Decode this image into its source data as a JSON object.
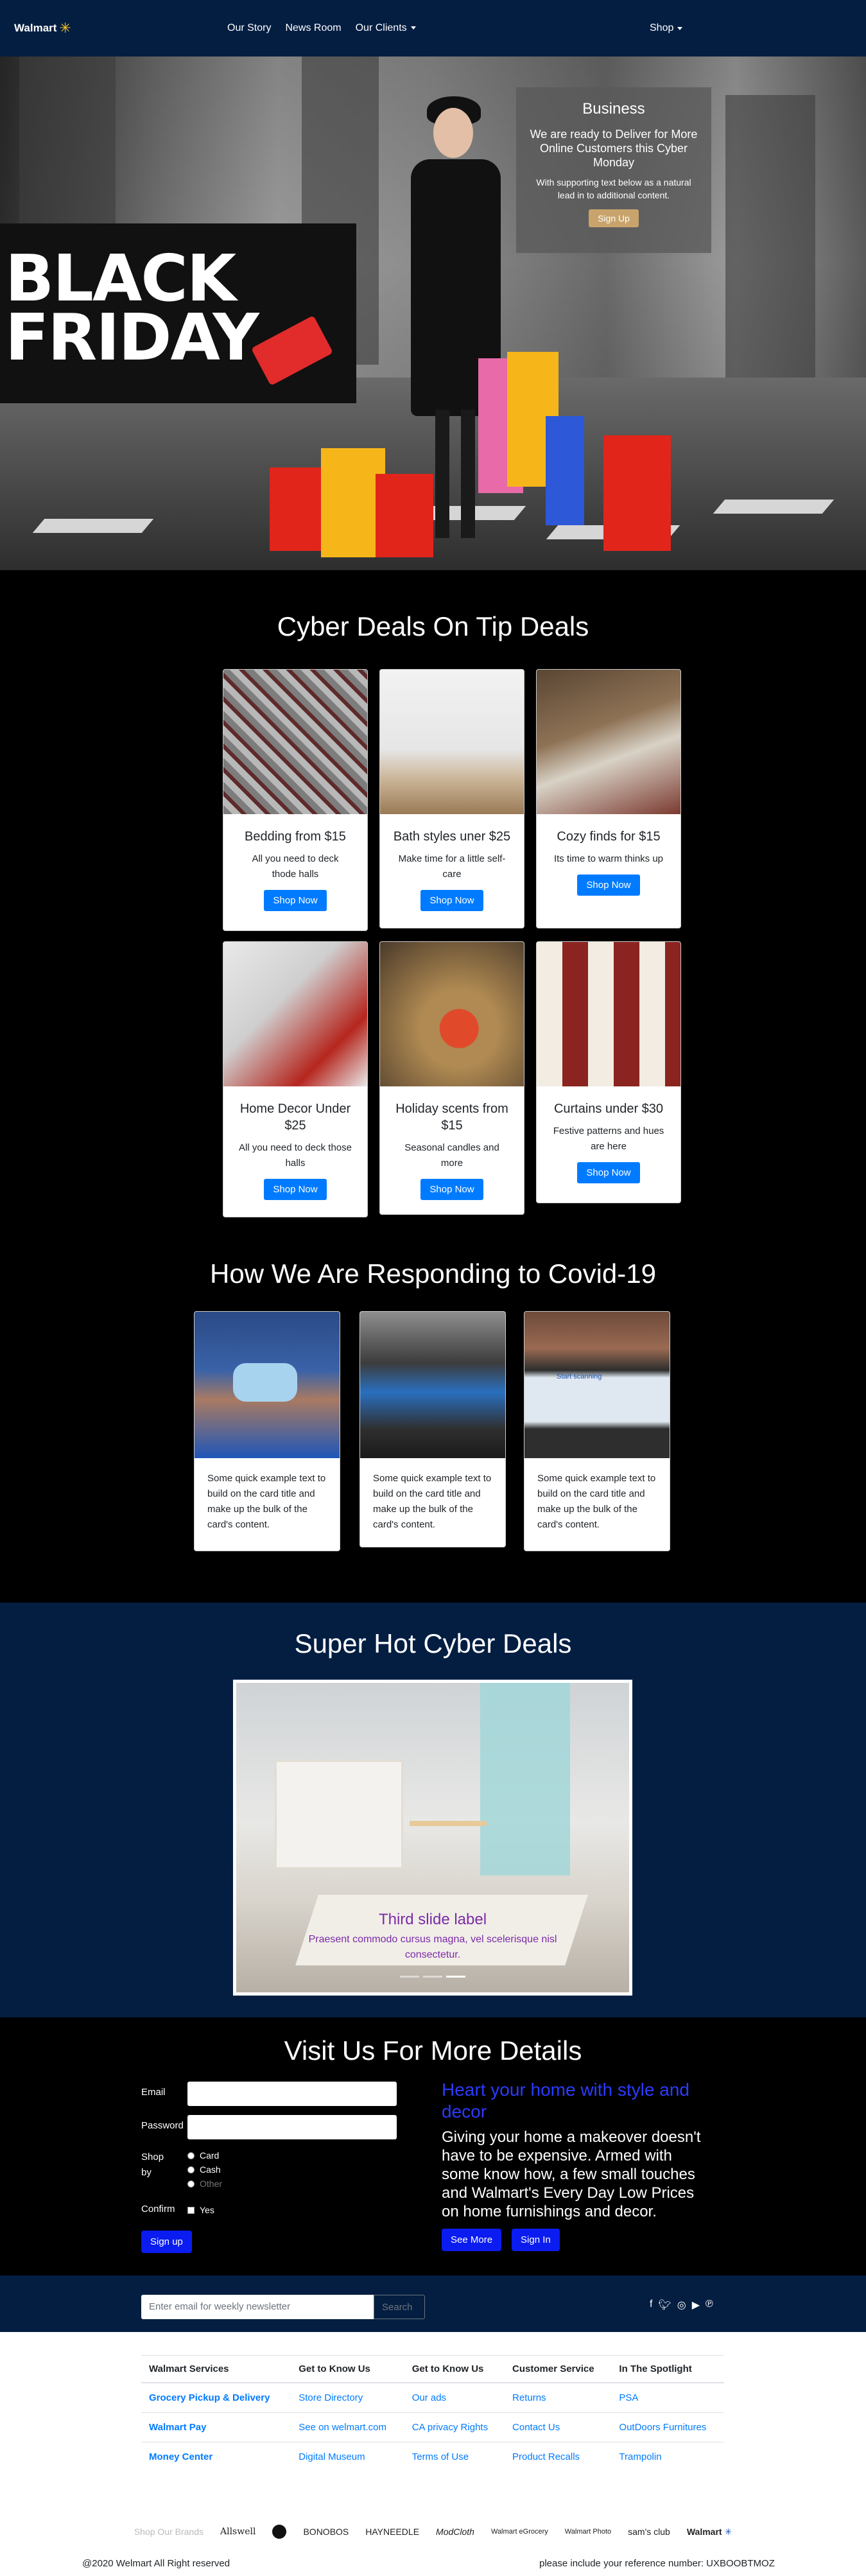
{
  "nav": {
    "brand": "Walmart",
    "links": [
      "Our Story",
      "News Room",
      "Our Clients"
    ],
    "shop": "Shop"
  },
  "hero": {
    "banner_text_line1": "BLACK",
    "banner_text_line2": "FRIDAY",
    "card_title": "Business",
    "card_lead": "We are ready to Deliver for More Online Customers this Cyber Monday",
    "card_small": "With supporting text below as a natural lead in to additional content.",
    "card_button": "Sign Up"
  },
  "deals": {
    "title": "Cyber Deals On Tip Deals",
    "cards": [
      {
        "title": "Bedding from $15",
        "text": "All you need to deck thode halls",
        "button": "Shop Now"
      },
      {
        "title": "Bath styles uner $25",
        "text": "Make time for a little self-care",
        "button": "Shop Now"
      },
      {
        "title": "Cozy finds for $15",
        "text": "Its time to warm thinks up",
        "button": "Shop Now"
      },
      {
        "title": "Home Decor Under $25",
        "text": "All you need to deck those halls",
        "button": "Shop Now"
      },
      {
        "title": "Holiday scents from $15",
        "text": "Seasonal candles and more",
        "button": "Shop Now"
      },
      {
        "title": "Curtains under $30",
        "text": "Festive patterns and hues are here",
        "button": "Shop Now"
      }
    ]
  },
  "covid": {
    "title": "How We Are Responding to Covid-19",
    "cards": [
      {
        "text": "Some quick example text to build on the card title and make up the bulk of the card's content."
      },
      {
        "text": "Some quick example text to build on the card title and make up the bulk of the card's content."
      },
      {
        "text": "Some quick example text to build on the card title and make up the bulk of the card's content."
      }
    ],
    "screen_text": "Start scanning"
  },
  "hot": {
    "title": "Super Hot Cyber Deals",
    "slide_label": "Third slide label",
    "slide_text": "Praesent commodo cursus magna, vel scelerisque nisl consectetur."
  },
  "visit": {
    "title": "Visit Us For More Details",
    "email_label": "Email",
    "password_label": "Password",
    "shop_label": "Shop by",
    "options": [
      "Card",
      "Cash",
      "Other"
    ],
    "confirm_label": "Confirm",
    "confirm_option": "Yes",
    "signup_button": "Sign up",
    "heading": "Heart your home with style and decor",
    "body": "Giving your home a makeover doesn't have to be expensive. Armed with some know how, a few small touches and Walmart's Every Day Low Prices on home furnishings and decor.",
    "see_more": "See More",
    "sign_in": "Sign In"
  },
  "newsletter": {
    "placeholder": "Enter email for weekly newsletter",
    "button": "Search",
    "socials": [
      "facebook-icon",
      "twitter-icon",
      "instagram-icon",
      "youtube-icon",
      "pinterest-icon"
    ]
  },
  "footer": {
    "headers": [
      "Walmart Services",
      "Get to Know Us",
      "Get to Know Us",
      "Customer Service",
      "In The Spotlight"
    ],
    "rows": [
      [
        "Grocery Pickup & Delivery",
        "Store Directory",
        "Our ads",
        "Returns",
        "PSA"
      ],
      [
        "Walmart Pay",
        "See on welmart.com",
        "CA privacy Rights",
        "Contact Us",
        "OutDoors Furnitures"
      ],
      [
        "Money Center",
        "Digital Museum",
        "Terms of Use",
        "Product Recalls",
        "Trampolin"
      ]
    ],
    "brands_label": "Shop Our Brands",
    "brands": [
      "Allswell",
      "BONOBOS",
      "HAYNEEDLE",
      "ModCloth",
      "Walmart eGrocery",
      "Walmart Photo",
      "sam's club",
      "Walmart"
    ],
    "copyright": "@2020 Welmart All Right reserved",
    "reference": "please include your reference number: UXBOOBTMOZ"
  },
  "colors": {
    "navy": "#041e42",
    "blue_button": "#007bff",
    "accent_gold": "#c8a36b",
    "spark_yellow": "#ffc220"
  }
}
